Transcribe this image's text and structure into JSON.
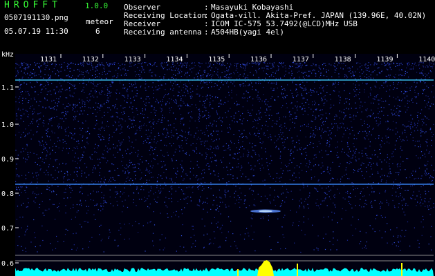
{
  "app": {
    "title": "HROFFT",
    "version": "1.0.0"
  },
  "file": {
    "name": "0507191130.png",
    "datetime": "05.07.19 11:30"
  },
  "meteor": {
    "label": "meteor",
    "count": "6"
  },
  "info": [
    {
      "label": "Observer",
      "value": "Masayuki Kobayashi"
    },
    {
      "label": "Receiving Location",
      "value": "Ogata-vill. Akita-Pref. JAPAN (139.96E, 40.02N)"
    },
    {
      "label": "Receiver",
      "value": "ICOM IC-575 53.7492(@LCD)MHz USB"
    },
    {
      "label": "Receiving antenna",
      "value": "A504HB(yagi 4el)"
    }
  ],
  "spectrogram": {
    "y_unit": "kHz",
    "y_ticks": [
      "1.1",
      "1.0",
      "0.9",
      "0.8",
      "0.7",
      "0.6"
    ],
    "x_ticks": [
      "1131",
      "1132",
      "1133",
      "1134",
      "1135",
      "1136",
      "1137",
      "1138",
      "1139",
      "1140"
    ],
    "colors": {
      "background": "#000010",
      "noise": "#1a2aa0",
      "signal": "#3fd0ff",
      "peak": "#ffff00",
      "text": "#ffffff"
    }
  }
}
